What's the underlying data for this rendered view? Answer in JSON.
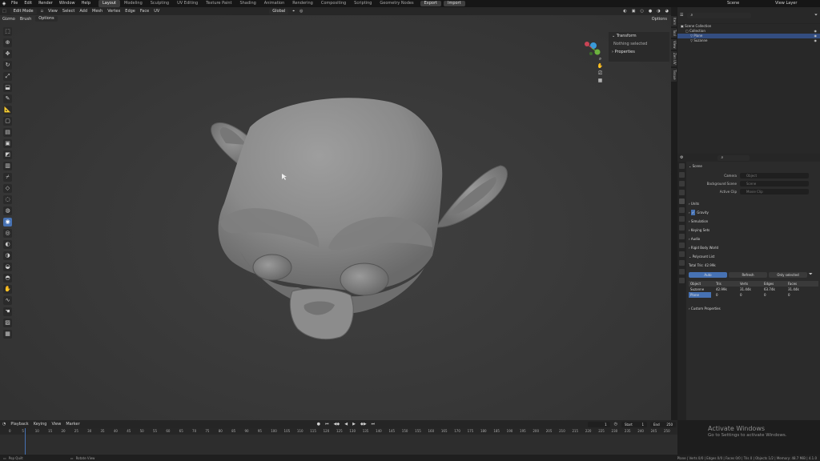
{
  "menu": {
    "logo_icon": "blender-logo-icon",
    "items": [
      "File",
      "Edit",
      "Render",
      "Window",
      "Help"
    ]
  },
  "workspaces": [
    "Layout",
    "Modeling",
    "Sculpting",
    "UV Editing",
    "Texture Paint",
    "Shading",
    "Animation",
    "Rendering",
    "Compositing",
    "Scripting",
    "Geometry Nodes"
  ],
  "import_export": [
    "Export",
    "Import"
  ],
  "scene_selector": "Scene",
  "view_layer": "View Layer",
  "viewport_header": {
    "object_mode": "Edit Mode",
    "menus": [
      "View",
      "Select",
      "Add",
      "Mesh",
      "Vertex",
      "Edge",
      "Face",
      "UV"
    ],
    "orientation": "Global",
    "options_label": "Options",
    "sub_items": [
      "Gizmo",
      "Brush",
      "Options"
    ]
  },
  "tools": [
    "select",
    "cursor",
    "move",
    "rotate",
    "scale",
    "transform",
    "annotate",
    "measure",
    "add-cube",
    "extrude",
    "inset",
    "bevel",
    "loop-cut",
    "knife",
    "poly-build",
    "spin",
    "smooth",
    "edge-slide",
    "shrink",
    "shear",
    "rip",
    "sculpt-draw",
    "clay",
    "crease",
    "blob",
    "grab",
    "snake",
    "thumb",
    "mask",
    "box-mask",
    "cloth",
    "face-set"
  ],
  "npanel": {
    "transform_label": "Transform",
    "nothing_selected": "Nothing selected",
    "properties_label": "Properties",
    "tabs": [
      "Item",
      "Tool",
      "View",
      "Zen UV",
      "Tissue"
    ]
  },
  "outliner": {
    "search_placeholder": "",
    "rows": [
      {
        "label": "Scene Collection",
        "selected": false
      },
      {
        "label": "Collection",
        "selected": false
      },
      {
        "label": "Plane",
        "selected": true
      },
      {
        "label": "Suzanne",
        "selected": false
      }
    ]
  },
  "properties": {
    "scene_label": "Scene",
    "fields": [
      {
        "label": "Camera",
        "value": "Object"
      },
      {
        "label": "Background Scene",
        "value": "Scene"
      },
      {
        "label": "Active Clip",
        "value": "Movie Clip"
      }
    ],
    "sections": [
      "Units",
      "Gravity",
      "Simulation",
      "Keying Sets",
      "Audio",
      "Rigid Body World",
      "Polycount List"
    ],
    "gravity_checked": true,
    "total_tris": "Total Tris: 42.99k",
    "buttons": [
      "Auto",
      "Refresh",
      "Only selected"
    ],
    "table_headers": [
      "Object",
      "Tris",
      "Verts",
      "Edges",
      "Faces"
    ],
    "table_rows": [
      [
        "Suzanne",
        "42.99k",
        "31.44k",
        "63.74k",
        "31.44k"
      ],
      [
        "Plane",
        "0",
        "0",
        "0",
        "0"
      ]
    ],
    "custom_props": "Custom Properties"
  },
  "timeline": {
    "menus": [
      "Playback",
      "Keying",
      "View",
      "Marker"
    ],
    "current_frame": "1",
    "start_label": "Start",
    "start": "1",
    "end_label": "End",
    "end": "250",
    "ticks": [
      "0",
      "5",
      "10",
      "15",
      "20",
      "25",
      "30",
      "35",
      "40",
      "45",
      "50",
      "55",
      "60",
      "65",
      "70",
      "75",
      "80",
      "85",
      "90",
      "95",
      "100",
      "105",
      "110",
      "115",
      "120",
      "125",
      "130",
      "135",
      "140",
      "145",
      "150",
      "155",
      "160",
      "165",
      "170",
      "175",
      "180",
      "185",
      "190",
      "195",
      "200",
      "205",
      "210",
      "215",
      "220",
      "225",
      "230",
      "235",
      "240",
      "245",
      "250"
    ]
  },
  "status": {
    "left": "Pop Quilt",
    "middle": "Rotate View",
    "right": "Plane | Verts 0/0 | Edges 0/0 | Faces 0/0 | Tris 0 | Objects 1/2 | Memory: 48.7 MiB | 4.1.0"
  },
  "watermark": {
    "title": "Activate Windows",
    "subtitle": "Go to Settings to activate Windows."
  }
}
